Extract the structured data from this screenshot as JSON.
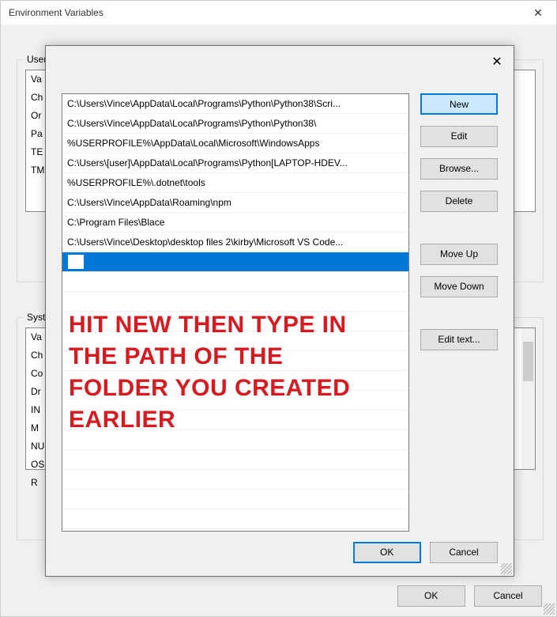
{
  "outer": {
    "title": "Environment Variables",
    "group1_legend": "User",
    "group2_legend": "Syste",
    "user_rows": [
      "Va",
      "Ch",
      "Or",
      "Pa",
      "TE",
      "TM"
    ],
    "sys_rows": [
      "Va",
      "Ch",
      "Co",
      "Dr",
      "IN",
      "M",
      "NU",
      "OS",
      "R"
    ],
    "ok": "OK",
    "cancel": "Cancel"
  },
  "inner": {
    "paths": [
      "C:\\Users\\Vince\\AppData\\Local\\Programs\\Python\\Python38\\Scri...",
      "C:\\Users\\Vince\\AppData\\Local\\Programs\\Python\\Python38\\",
      "%USERPROFILE%\\AppData\\Local\\Microsoft\\WindowsApps",
      "C:\\Users\\[user]\\AppData\\Local\\Programs\\Python[LAPTOP-HDEV...",
      "%USERPROFILE%\\.dotnet\\tools",
      "C:\\Users\\Vince\\AppData\\Roaming\\npm",
      "C:\\Program Files\\Blace",
      "C:\\Users\\Vince\\Desktop\\desktop files 2\\kirby\\Microsoft VS Code..."
    ],
    "btn_new": "New",
    "btn_edit": "Edit",
    "btn_browse": "Browse...",
    "btn_delete": "Delete",
    "btn_moveup": "Move Up",
    "btn_movedown": "Move Down",
    "btn_edittext": "Edit text...",
    "btn_ok": "OK",
    "btn_cancel": "Cancel"
  },
  "annotation": "HIT NEW THEN TYPE IN THE PATH OF THE FOLDER YOU CREATED EARLIER"
}
